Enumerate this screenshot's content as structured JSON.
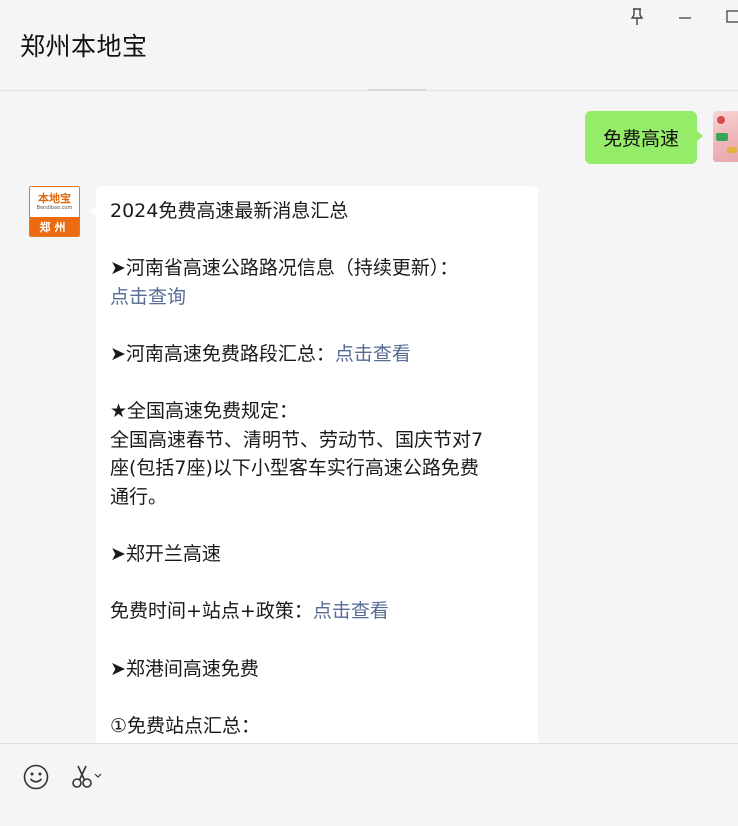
{
  "window": {
    "title": "郑州本地宝",
    "controls": [
      "pin-icon",
      "minimize-icon",
      "maximize-icon"
    ]
  },
  "chat": {
    "outgoing": {
      "text": "免费高速"
    },
    "incoming_avatar": {
      "logo_text": "本地宝",
      "logo_sub": "Bendibao.com",
      "city": "郑州"
    },
    "incoming": {
      "title": "2024免费高速最新消息汇总",
      "item1_prefix": "➤河南省高速公路路况信息（持续更新）：",
      "item1_link": "点击查询",
      "item2_prefix": "➤河南高速免费路段汇总：",
      "item2_link": "点击查看",
      "rules_heading": "★全国高速免费规定：",
      "rules_text_1": "全国高速春节、清明节、劳动节、国庆节对7",
      "rules_text_2": "座(包括7座)以下小型客车实行高速公路免费",
      "rules_text_3": "通行。",
      "item3": "➤郑开兰高速",
      "item3_detail_prefix": "免费时间+站点+政策：",
      "item3_detail_link": "点击查看",
      "item4": "➤郑港间高速免费",
      "item4_sub": "①免费站点汇总："
    }
  },
  "toolbar": {
    "icons": [
      "emoji-icon",
      "scissors-icon"
    ]
  },
  "colors": {
    "outgoing_bubble": "#95ec69",
    "link": "#576b95",
    "brand_orange": "#ec6a10"
  }
}
